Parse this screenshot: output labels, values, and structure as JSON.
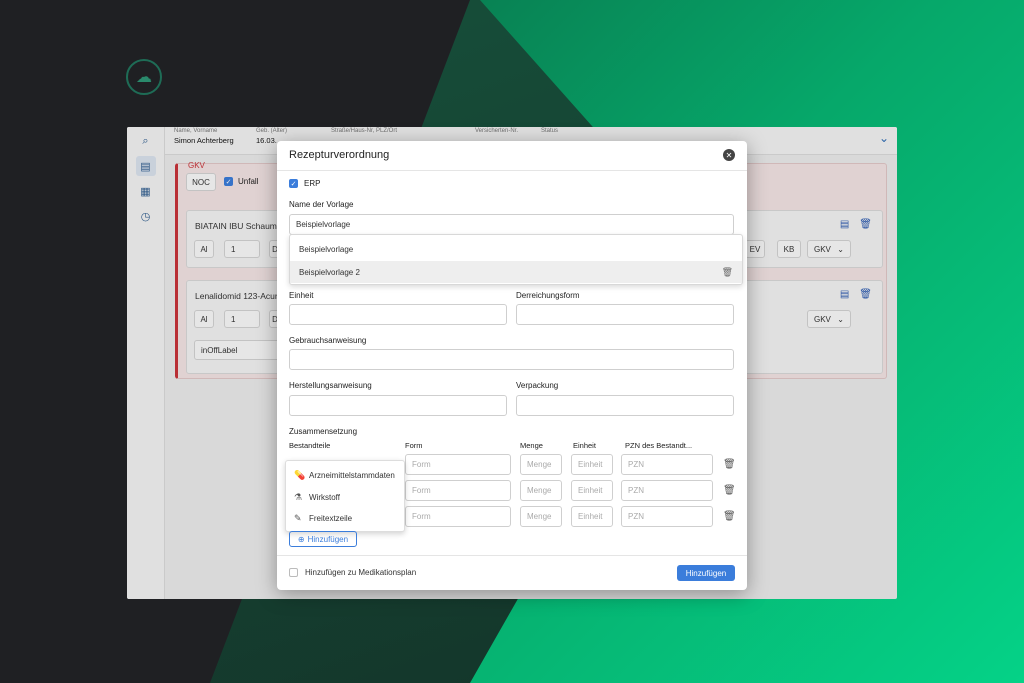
{
  "topbar": {
    "name_label": "Name, Vorname",
    "name_value": "Simon Achterberg",
    "birth_label": "Geb. (Alter)",
    "birth_value": "16.03.",
    "address_label": "Straße/Haus-Nr, PLZ/Ort",
    "insurance_label": "Versicherten-Nr.",
    "status_label": "Status"
  },
  "gkv": {
    "label": "GKV",
    "noc": "NOC",
    "unfall": "Unfall"
  },
  "items": [
    {
      "title": "BIATAIN IBU Schaumv",
      "al": "Al",
      "qty": "1",
      "d": "D",
      "ev": "EV",
      "kb": "KB",
      "ins": "GKV"
    },
    {
      "title": "Lenalidomid 123-Acura",
      "al": "Al",
      "qty": "1",
      "d": "D",
      "ins": "GKV",
      "note": "inOffLabel"
    }
  ],
  "modal": {
    "title": "Rezepturverordnung",
    "erp_label": "ERP",
    "template_label": "Name der Vorlage",
    "template_value": "Beispielvorlage",
    "dropdown_options": [
      "Beispielvorlage",
      "Beispielvorlage 2"
    ],
    "einheit_label": "Einheit",
    "darreichung_label": "Derreichungsform",
    "gebrauch_label": "Gebrauchsanweisung",
    "herstellung_label": "Herstellungsanweisung",
    "verpackung_label": "Verpackung",
    "zusammensetzung_label": "Zusammensetzung",
    "columns": [
      "Bestandteile",
      "Form",
      "Menge",
      "Einheit",
      "PZN des Bestandt..."
    ],
    "placeholders": {
      "form": "Form",
      "menge": "Menge",
      "einheit": "Einheit",
      "pzn": "PZN"
    },
    "context_menu": [
      "Arzneimittelstammdaten",
      "Wirkstoff",
      "Freitextzeile"
    ],
    "add_row": "Hinzufügen",
    "med_plan_label": "Hinzufügen zu Medikationsplan",
    "submit": "Hinzufügen"
  },
  "colors": {
    "primary": "#3b7ddb",
    "danger": "#c9343a"
  }
}
